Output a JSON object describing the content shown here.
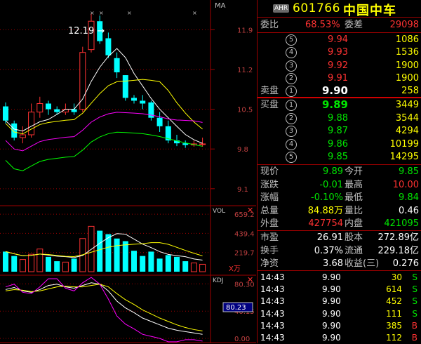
{
  "header": {
    "badge": "AHR",
    "code": "601766",
    "name": "中国中车"
  },
  "wei": {
    "ratio_label": "委比",
    "ratio_value": "68.53%",
    "diff_label": "委差",
    "diff_value": "29098"
  },
  "sell_label": "卖盘",
  "buy_label": "买盘",
  "asks": [
    {
      "level": "⑤",
      "price": "9.94",
      "vol": "1086"
    },
    {
      "level": "④",
      "price": "9.93",
      "vol": "1536"
    },
    {
      "level": "③",
      "price": "9.92",
      "vol": "1900"
    },
    {
      "level": "②",
      "price": "9.91",
      "vol": "1900"
    },
    {
      "level": "①",
      "price": "9.90",
      "vol": "258"
    }
  ],
  "bids": [
    {
      "level": "①",
      "price": "9.89",
      "vol": "3449"
    },
    {
      "level": "②",
      "price": "9.88",
      "vol": "3544"
    },
    {
      "level": "③",
      "price": "9.87",
      "vol": "4294"
    },
    {
      "level": "④",
      "price": "9.86",
      "vol": "10199"
    },
    {
      "level": "⑤",
      "price": "9.85",
      "vol": "14295"
    }
  ],
  "quote": [
    {
      "l1": "现价",
      "v1": "9.89",
      "l2": "今开",
      "v2": "9.85"
    },
    {
      "l1": "涨跌",
      "v1": "-0.01",
      "l2": "最高",
      "v2": "10.00"
    },
    {
      "l1": "涨幅",
      "v1": "-0.10%",
      "l2": "最低",
      "v2": "9.84"
    },
    {
      "l1": "总量",
      "v1": "84.88万",
      "l2": "量比",
      "v2": "0.46"
    },
    {
      "l1": "外盘",
      "v1": "427754",
      "l2": "内盘",
      "v2": "421095"
    }
  ],
  "fund": [
    {
      "l1": "市盈",
      "v1": "26.91",
      "l2": "股本",
      "v2": "272.89亿"
    },
    {
      "l1": "换手",
      "v1": "0.37%",
      "l2": "流通",
      "v2": "229.18亿"
    },
    {
      "l1": "净资",
      "v1": "3.68",
      "l2": "收益(三)",
      "v2": "0.276"
    }
  ],
  "ticks": [
    {
      "time": "14:43",
      "price": "9.90",
      "vol": "30",
      "bs": "S"
    },
    {
      "time": "14:43",
      "price": "9.90",
      "vol": "614",
      "bs": "S"
    },
    {
      "time": "14:43",
      "price": "9.90",
      "vol": "452",
      "bs": "S"
    },
    {
      "time": "14:43",
      "price": "9.90",
      "vol": "111",
      "bs": "S"
    },
    {
      "time": "14:43",
      "price": "9.90",
      "vol": "385",
      "bs": "B"
    },
    {
      "time": "14:43",
      "price": "9.90",
      "vol": "112",
      "bs": "B"
    }
  ],
  "chart": {
    "ma_label": "MA",
    "vol_label": "VOL",
    "kdj_label": "KDJ",
    "peak_label": "12.19",
    "price_axis": [
      "11.9",
      "11.2",
      "10.5",
      "9.8",
      "9.1"
    ],
    "vol_axis": [
      "659.2",
      "439.4",
      "219.7"
    ],
    "vol_unit": "X万",
    "kdj_axis": [
      "80.30",
      "40.15",
      "0.00"
    ],
    "kdj_value": "80.23",
    "close_symbol": "✕",
    "candles": [
      [
        10.55,
        10.3,
        10.62,
        10.25
      ],
      [
        10.25,
        10.0,
        10.3,
        9.95
      ],
      [
        10.0,
        10.05,
        10.2,
        9.9
      ],
      [
        10.05,
        10.45,
        10.6,
        10.0
      ],
      [
        10.45,
        10.6,
        10.72,
        10.35
      ],
      [
        10.6,
        10.5,
        10.65,
        10.4
      ],
      [
        10.5,
        10.45,
        10.55,
        10.4
      ],
      [
        10.45,
        10.5,
        10.6,
        10.4
      ],
      [
        10.5,
        10.45,
        10.6,
        10.4
      ],
      [
        10.5,
        11.5,
        11.6,
        10.45
      ],
      [
        11.55,
        12.05,
        12.19,
        11.5
      ],
      [
        12.05,
        11.7,
        12.15,
        11.65
      ],
      [
        11.75,
        11.45,
        11.85,
        11.4
      ],
      [
        11.4,
        11.15,
        11.5,
        11.05
      ],
      [
        11.1,
        10.7,
        11.1,
        10.65
      ],
      [
        10.7,
        10.65,
        10.75,
        10.6
      ],
      [
        10.65,
        10.6,
        10.75,
        10.5
      ],
      [
        10.62,
        10.35,
        10.65,
        10.3
      ],
      [
        10.35,
        10.2,
        10.45,
        10.1
      ],
      [
        10.2,
        9.95,
        10.3,
        9.9
      ],
      [
        9.95,
        9.9,
        10.05,
        9.85
      ],
      [
        9.9,
        9.87,
        9.95,
        9.82
      ],
      [
        9.87,
        9.89,
        9.95,
        9.84
      ],
      [
        9.89,
        9.89,
        10.0,
        9.84
      ]
    ],
    "volumes": [
      230,
      180,
      140,
      200,
      260,
      170,
      120,
      110,
      150,
      380,
      520,
      470,
      430,
      380,
      350,
      240,
      180,
      230,
      150,
      190,
      170,
      120,
      100,
      85
    ]
  },
  "colors": {
    "up": "#ff3232",
    "down": "#00ffff",
    "ma5": "#ffffff",
    "ma10": "#ffff00",
    "ma20": "#ff00ff",
    "ma60": "#00ff00",
    "grid": "#a00000"
  }
}
